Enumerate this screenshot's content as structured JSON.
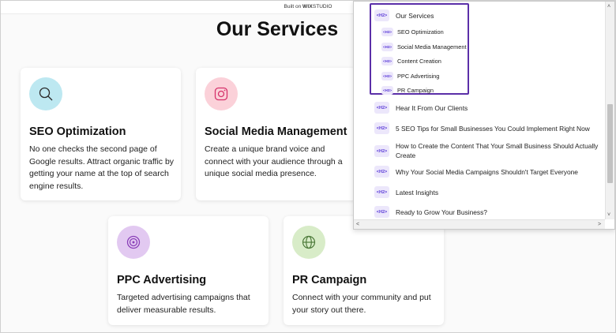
{
  "builtOn": {
    "prefix": "Built on",
    "brand_wix": "WIX",
    "brand_studio": "STUDIO"
  },
  "title": "Our Services",
  "cards": [
    {
      "title": "SEO Optimization",
      "desc": "No one checks the second page of Google results. Attract organic traffic by getting your name at the top of search engine results.",
      "icon": "search-icon",
      "color": "#bde8f1"
    },
    {
      "title": "Social Media Management",
      "desc": "Create a unique brand voice and connect with your audience through a unique social media presence.",
      "icon": "instagram-icon",
      "color": "#fbd1d9"
    },
    {
      "title": "PPC Advertising",
      "desc": "Targeted advertising campaigns that deliver measurable results.",
      "icon": "target-icon",
      "color": "#e2c9f1"
    },
    {
      "title": "PR Campaign",
      "desc": "Connect with your community and put your story out there.",
      "icon": "globe-icon",
      "color": "#d8ecc8"
    }
  ],
  "toc": {
    "badge_main": "<H2>",
    "badge_sub": "<H3>",
    "items": [
      {
        "label": "Our Services",
        "level": "h2"
      },
      {
        "label": "SEO Optimization",
        "level": "h3"
      },
      {
        "label": "Social Media Management",
        "level": "h3"
      },
      {
        "label": "Content Creation",
        "level": "h3"
      },
      {
        "label": "PPC Advertising",
        "level": "h3"
      },
      {
        "label": "PR Campaign",
        "level": "h3"
      },
      {
        "label": "Hear It From Our Clients",
        "level": "h2"
      },
      {
        "label": "5 SEO Tips for Small Businesses You Could Implement Right Now",
        "level": "h2"
      },
      {
        "label": "How to Create the Content That Your Small Business Should Actually Create",
        "level": "h2"
      },
      {
        "label": "Why Your Social Media Campaigns Shouldn't Target Everyone",
        "level": "h2"
      },
      {
        "label": "Latest Insights",
        "level": "h2"
      },
      {
        "label": "Ready to Grow Your Business?",
        "level": "h2"
      }
    ]
  },
  "scroll_arrows": {
    "up": "˄",
    "down": "˅",
    "left": "<",
    "right": ">"
  }
}
